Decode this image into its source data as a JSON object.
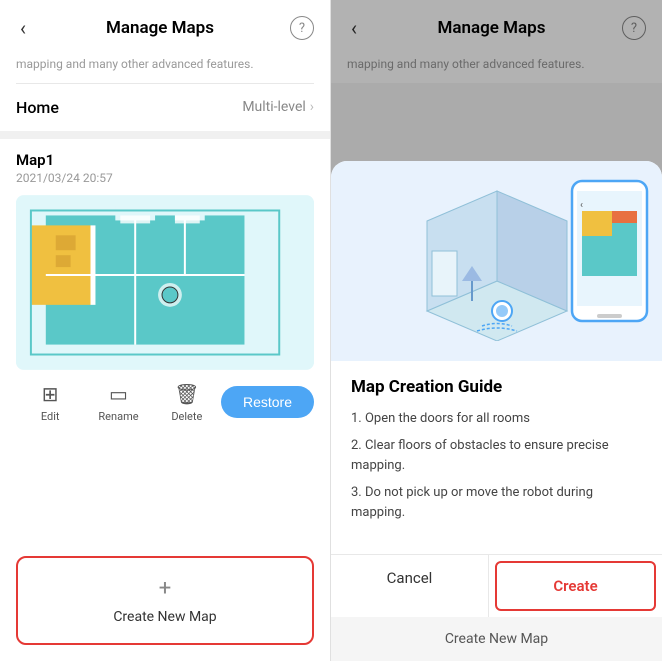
{
  "left": {
    "header": {
      "title": "Manage Maps",
      "back_label": "‹",
      "help_label": "?"
    },
    "sub_text": "mapping and many other advanced features.",
    "home": {
      "label": "Home",
      "type": "Multi-level"
    },
    "map": {
      "name": "Map1",
      "date": "2021/03/24 20:57"
    },
    "actions": {
      "edit": "Edit",
      "rename": "Rename",
      "delete": "Delete",
      "restore": "Restore"
    },
    "create_new_map": {
      "label": "Create New Map",
      "plus": "+"
    }
  },
  "right": {
    "header": {
      "title": "Manage Maps",
      "back_label": "‹",
      "help_label": "?"
    },
    "sub_text": "mapping and many other advanced features.",
    "modal": {
      "title": "Map Creation Guide",
      "steps": [
        "1. Open the doors for all rooms",
        "2. Clear floors of obstacles to ensure precise mapping.",
        "3. Do not pick up or move the robot during mapping."
      ],
      "cancel": "Cancel",
      "create": "Create"
    },
    "bottom_label": "Create New Map"
  },
  "colors": {
    "accent_blue": "#4da6f5",
    "accent_red": "#e53935",
    "map_teal": "#5ac8c8",
    "map_yellow": "#f0c040",
    "map_orange": "#e87040"
  }
}
